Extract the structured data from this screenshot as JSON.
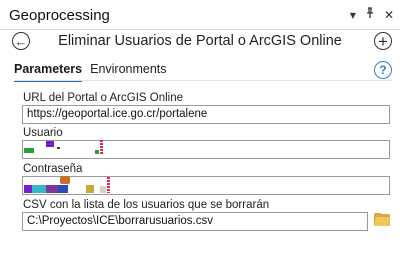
{
  "pane": {
    "title": "Geoprocessing",
    "controls": {
      "menu": "▾",
      "pin": "⫯",
      "close": "✕"
    }
  },
  "tool": {
    "name": "Eliminar Usuarios de Portal o ArcGIS Online",
    "back_icon": "back-arrow-circle-icon",
    "add_icon": "add-circle-icon"
  },
  "tabs": [
    {
      "label": "Parameters",
      "active": true
    },
    {
      "label": "Environments",
      "active": false
    }
  ],
  "help_icon": "help-question-icon",
  "params": [
    {
      "label": "URL del Portal o ArcGIS Online",
      "value": "https://geoportal.ice.go.cr/portalene"
    },
    {
      "label": "Usuario",
      "value": ""
    },
    {
      "label": "Contraseña",
      "value": ""
    },
    {
      "label": "CSV con la lista de los usuarios que se borrarán",
      "value": "C:\\Proyectos\\ICE\\borrarusuarios.csv"
    }
  ],
  "browse_icon": "folder-open-icon",
  "colors": {
    "accent": "#1b6ac9",
    "help": "#2f7fd0",
    "border": "#9a9a9a"
  }
}
